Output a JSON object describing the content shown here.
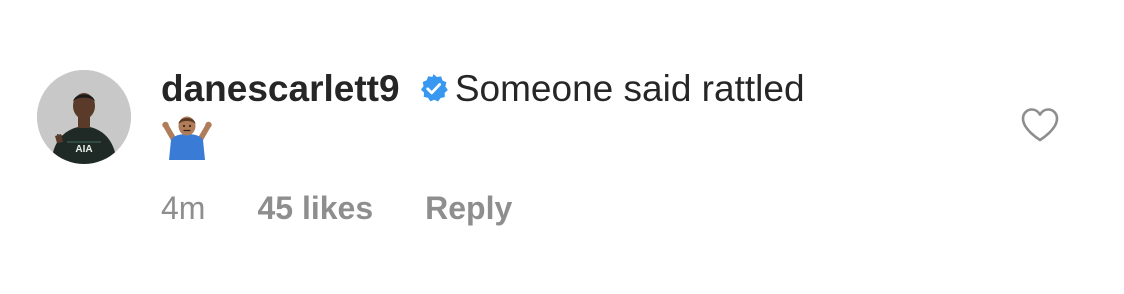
{
  "comment": {
    "username": "danescarlett9",
    "text": "Someone said rattled",
    "emoji": "🤷🏽‍♂️",
    "time": "4m",
    "likes": "45 likes",
    "reply_label": "Reply",
    "verified": true,
    "avatar_jersey_text": "AIA"
  },
  "icons": {
    "verified": "verified-badge-icon",
    "like": "heart-outline-icon"
  },
  "colors": {
    "text": "#262626",
    "meta": "#8e8e8e",
    "verified": "#3897f0"
  }
}
